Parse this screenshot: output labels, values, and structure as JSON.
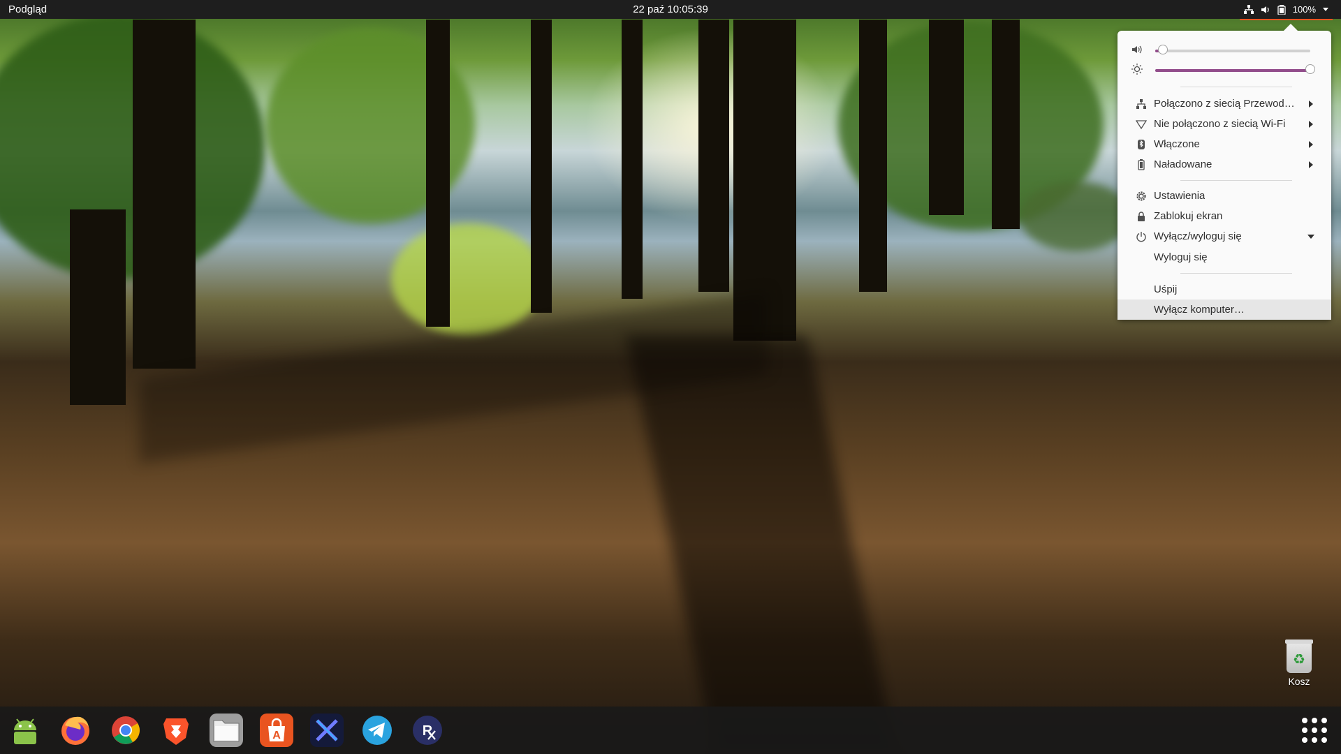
{
  "topbar": {
    "activities_label": "Podgląd",
    "clock": "22 paź  10:05:39",
    "battery_label": "100%"
  },
  "system_menu": {
    "volume_level": 0.05,
    "brightness_level": 1.0,
    "items": {
      "wired": "Połączono z siecią Przewod…",
      "wifi": "Nie połączono z siecią Wi-Fi",
      "bluetooth": "Włączone",
      "battery": "Naładowane",
      "settings": "Ustawienia",
      "lock": "Zablokuj ekran",
      "power": "Wyłącz/wyloguj się",
      "logout": "Wyloguj się",
      "suspend": "Uśpij",
      "shutdown": "Wyłącz komputer…"
    }
  },
  "desktop": {
    "trash_label": "Kosz"
  },
  "dock": {
    "apps": [
      "android-studio-icon",
      "firefox-icon",
      "chrome-icon",
      "brave-icon",
      "files-icon",
      "software-center-icon",
      "exodus-icon",
      "telegram-icon",
      "rx-app-icon"
    ]
  },
  "colors": {
    "accent": "#e95420",
    "slider": "#924d8b",
    "topbar": "#1e1e1e"
  }
}
